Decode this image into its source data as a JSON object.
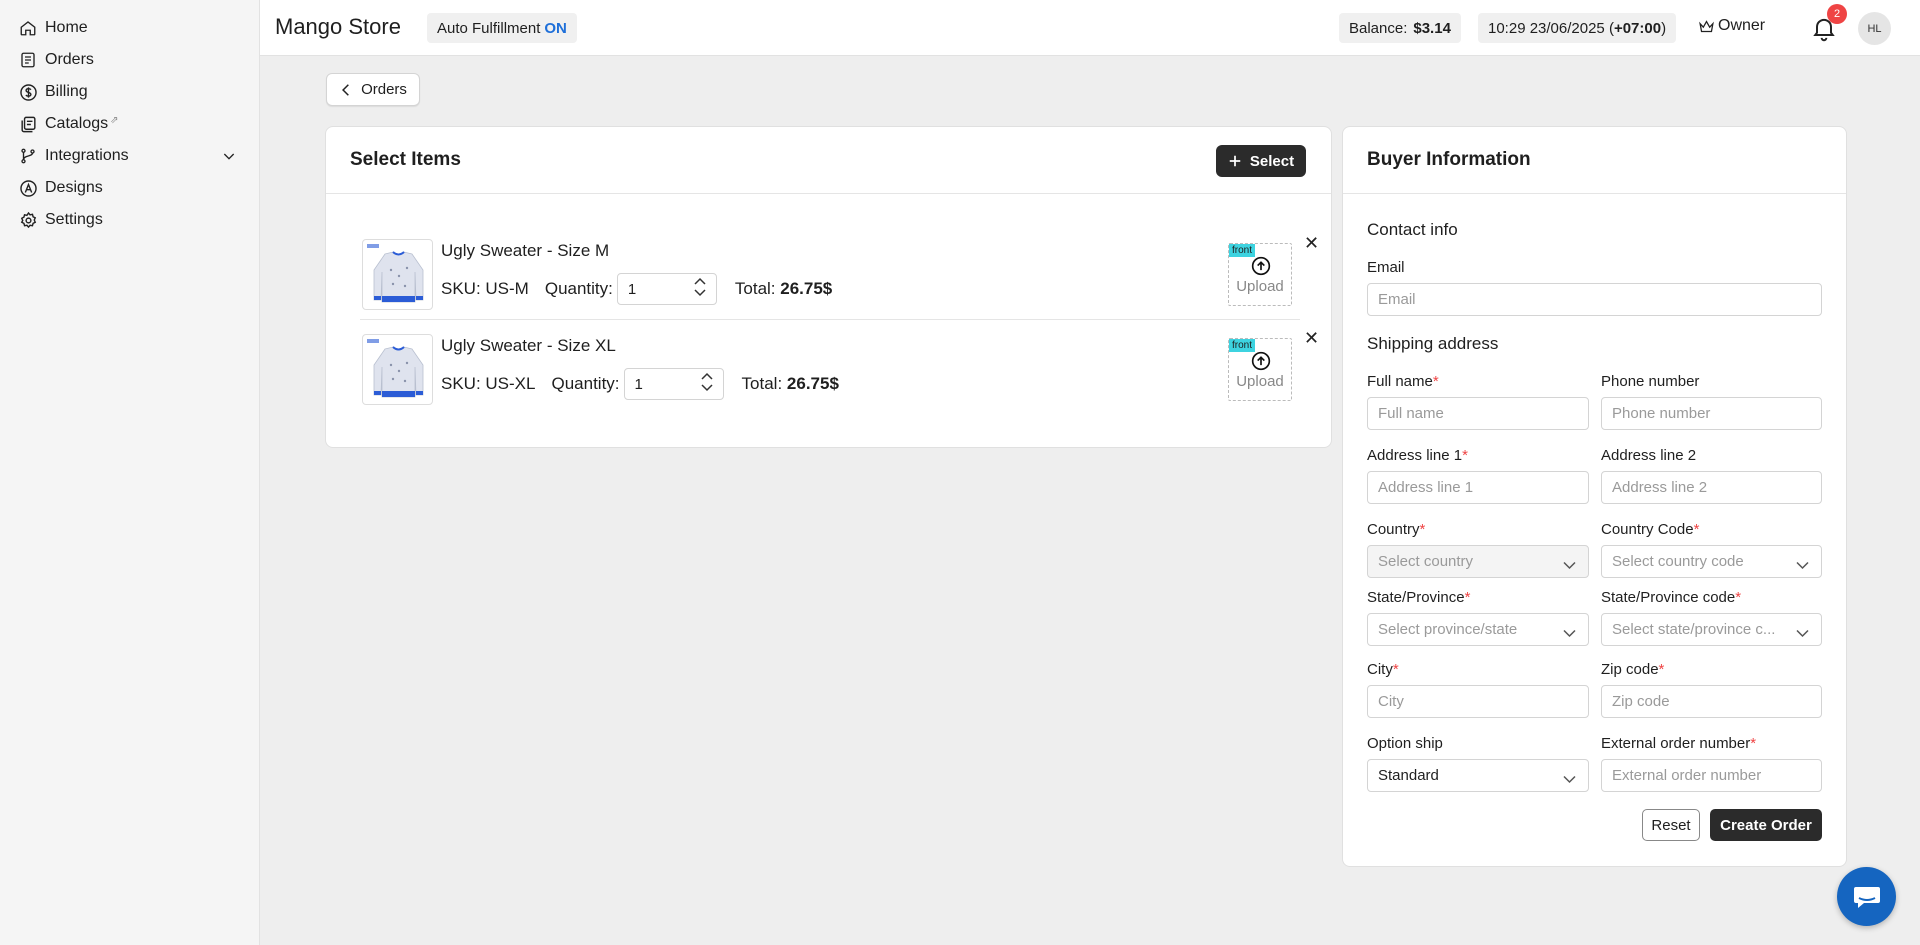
{
  "sidebar": {
    "items": [
      {
        "label": "Home",
        "icon": "home-icon"
      },
      {
        "label": "Orders",
        "icon": "orders-icon"
      },
      {
        "label": "Billing",
        "icon": "dollar-icon"
      },
      {
        "label": "Catalogs",
        "icon": "catalog-icon",
        "external": "⇗"
      },
      {
        "label": "Integrations",
        "icon": "integrations-icon"
      },
      {
        "label": "Designs",
        "icon": "designs-icon"
      },
      {
        "label": "Settings",
        "icon": "gear-icon"
      }
    ]
  },
  "header": {
    "store_name": "Mango Store",
    "auto_fulfillment_label": "Auto Fulfillment",
    "auto_fulfillment_state": "ON",
    "balance_label": "Balance:",
    "balance_value": "$3.14",
    "datetime": "10:29 23/06/2025 (",
    "timezone": "+07:00",
    "datetime_close": ")",
    "role": "Owner",
    "notification_count": "2",
    "avatar_initials": "HL"
  },
  "back_button": {
    "label": "Orders"
  },
  "select_items": {
    "title": "Select Items",
    "select_button": "Select",
    "items": [
      {
        "name": "Ugly Sweater - Size M",
        "sku": "SKU: US-M",
        "quantity_label": "Quantity:",
        "quantity": "1",
        "total_label": "Total:",
        "total": "26.75$",
        "side": "front",
        "upload": "Upload"
      },
      {
        "name": "Ugly Sweater - Size XL",
        "sku": "SKU: US-XL",
        "quantity_label": "Quantity:",
        "quantity": "1",
        "total_label": "Total:",
        "total": "26.75$",
        "side": "front",
        "upload": "Upload"
      }
    ]
  },
  "buyer": {
    "title": "Buyer Information",
    "contact_title": "Contact info",
    "email_label": "Email",
    "email_placeholder": "Email",
    "shipping_title": "Shipping address",
    "full_name_label": "Full name",
    "full_name_placeholder": "Full name",
    "phone_label": "Phone number",
    "phone_placeholder": "Phone number",
    "address1_label": "Address line 1",
    "address1_placeholder": "Address line 1",
    "address2_label": "Address line 2",
    "address2_placeholder": "Address line 2",
    "country_label": "Country",
    "country_placeholder": "Select country",
    "country_code_label": "Country Code",
    "country_code_placeholder": "Select country code",
    "state_label": "State/Province",
    "state_placeholder": "Select province/state",
    "state_code_label": "State/Province code",
    "state_code_placeholder": "Select state/province c...",
    "city_label": "City",
    "city_placeholder": "City",
    "zip_label": "Zip code",
    "zip_placeholder": "Zip code",
    "option_ship_label": "Option ship",
    "option_ship_value": "Standard",
    "external_order_label": "External order number",
    "external_order_placeholder": "External order number",
    "required_mark": "*",
    "reset_button": "Reset",
    "create_button": "Create Order"
  },
  "colors": {
    "accent_on": "#1e6fd9",
    "dark_button": "#2b2b2b",
    "required": "#ef4444",
    "chat": "#1565c0",
    "front_tag": "#3dd3e0"
  }
}
